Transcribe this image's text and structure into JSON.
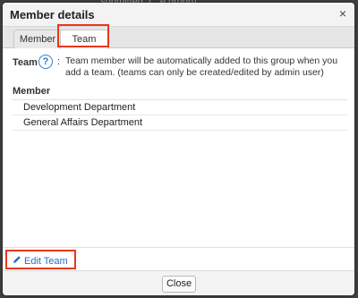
{
  "background": {
    "partial_text": "... submitted. (...e group)"
  },
  "dialog": {
    "title": "Member details",
    "close_icon": "×",
    "tabs": [
      {
        "label": "Member",
        "active": false
      },
      {
        "label": "Team",
        "active": true
      }
    ],
    "team": {
      "label": "Team",
      "help_icon": "?",
      "colon": ":",
      "description": "Team member will be automatically added to this group when you add a team. (teams can only be created/edited by admin user)"
    },
    "member_header": "Member",
    "members": [
      {
        "name": "Development Department"
      },
      {
        "name": "General Affairs Department"
      }
    ],
    "edit_team": {
      "icon": "pencil-icon",
      "label": "Edit Team"
    },
    "close_button": "Close"
  },
  "colors": {
    "highlight": "#e8361c",
    "link": "#2a6fbf",
    "help": "#2a7fd0"
  }
}
